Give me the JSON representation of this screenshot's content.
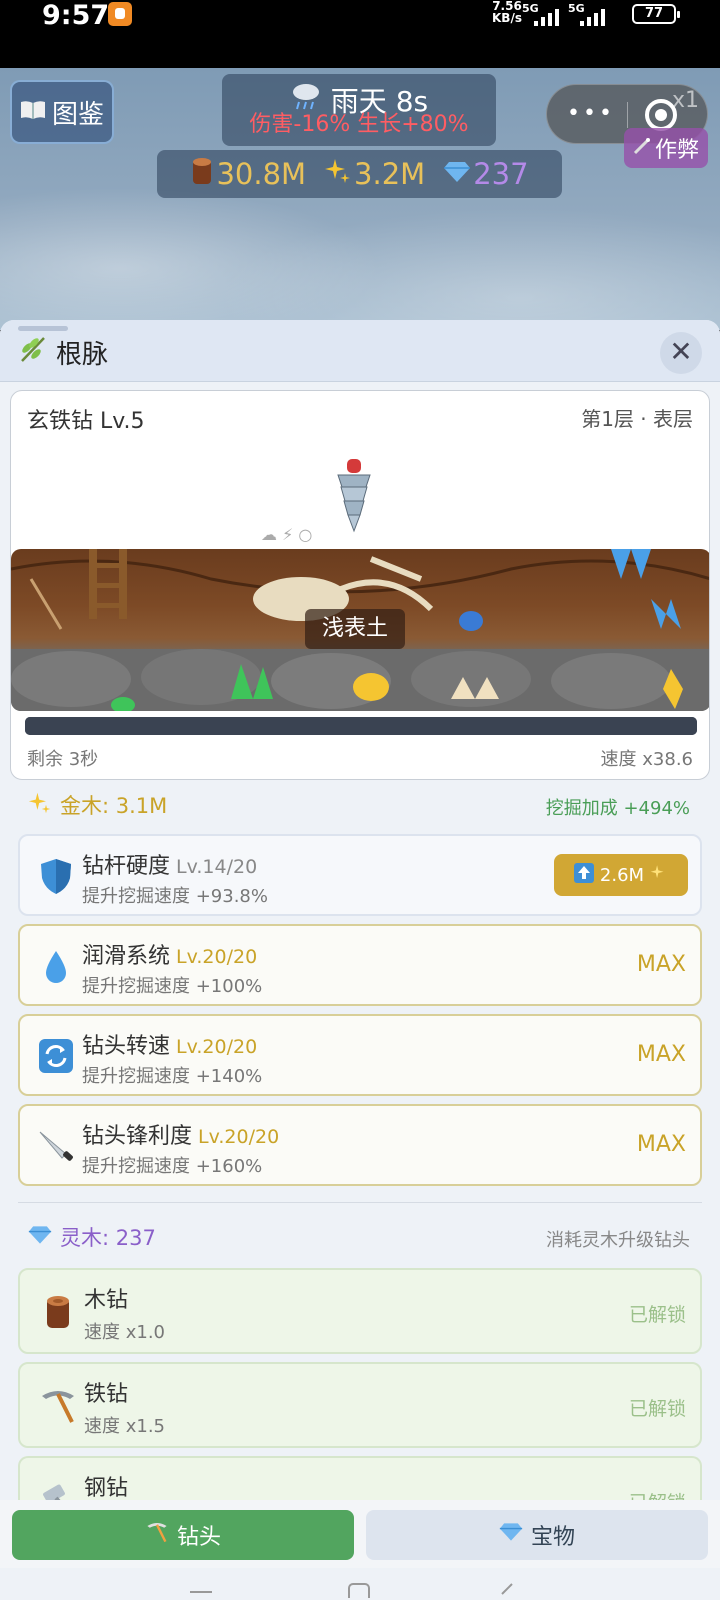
{
  "status_bar": {
    "time": "9:57",
    "speed_value": "7.56",
    "speed_unit": "KB/s",
    "sim1": "5G",
    "sim2": "5G",
    "battery": "77"
  },
  "top_hud": {
    "codex_label": "图鉴",
    "weather_title": "雨天 8s",
    "weather_effect": "伤害-16% 生长+80%",
    "resources": [
      {
        "icon": "wood-log-icon",
        "value": "30.8M",
        "color": "#e8c15a"
      },
      {
        "icon": "sparkle-icon",
        "value": "3.2M",
        "color": "#e8c15a"
      },
      {
        "icon": "diamond-icon",
        "value": "237",
        "color": "#b48ae8"
      }
    ],
    "speed_multiplier": "x1",
    "cheat_label": "作弊"
  },
  "panel": {
    "title": "根脉",
    "drill": {
      "name": "玄铁钻 Lv.5",
      "layer": "第1层 · 表层",
      "soil_label": "浅表土",
      "remaining": "剩余 3秒",
      "speed": "速度 x38.6",
      "progress": 1.0
    },
    "gold_wood": {
      "label": "金木: 3.1M",
      "bonus": "挖掘加成 +494%",
      "upgrades": [
        {
          "name": "钻杆硬度",
          "level": "Lv.14/20",
          "desc": "提升挖掘速度 +93.8%",
          "cost": "2.6M",
          "icon": "shield-icon",
          "state": ""
        },
        {
          "name": "润滑系统",
          "level": "Lv.20/20",
          "desc": "提升挖掘速度 +100%",
          "icon": "droplet-icon",
          "state": "MAX"
        },
        {
          "name": "钻头转速",
          "level": "Lv.20/20",
          "desc": "提升挖掘速度 +140%",
          "icon": "refresh-icon",
          "state": "MAX"
        },
        {
          "name": "钻头锋利度",
          "level": "Lv.20/20",
          "desc": "提升挖掘速度 +160%",
          "icon": "knife-icon",
          "state": "MAX"
        }
      ]
    },
    "spirit_wood": {
      "label": "灵木: 237",
      "hint": "消耗灵木升级钻头",
      "bits": [
        {
          "name": "木钻",
          "desc": "速度 x1.0",
          "state": "已解锁",
          "icon": "wood-log-icon"
        },
        {
          "name": "铁钻",
          "desc": "速度 x1.5",
          "state": "已解锁",
          "icon": "pickaxe-icon"
        },
        {
          "name": "钢钻",
          "desc": "",
          "state": "已解锁",
          "icon": "hammer-icon"
        }
      ]
    }
  },
  "bottom_tabs": {
    "drill_tab": "钻头",
    "treasure_tab": "宝物"
  }
}
